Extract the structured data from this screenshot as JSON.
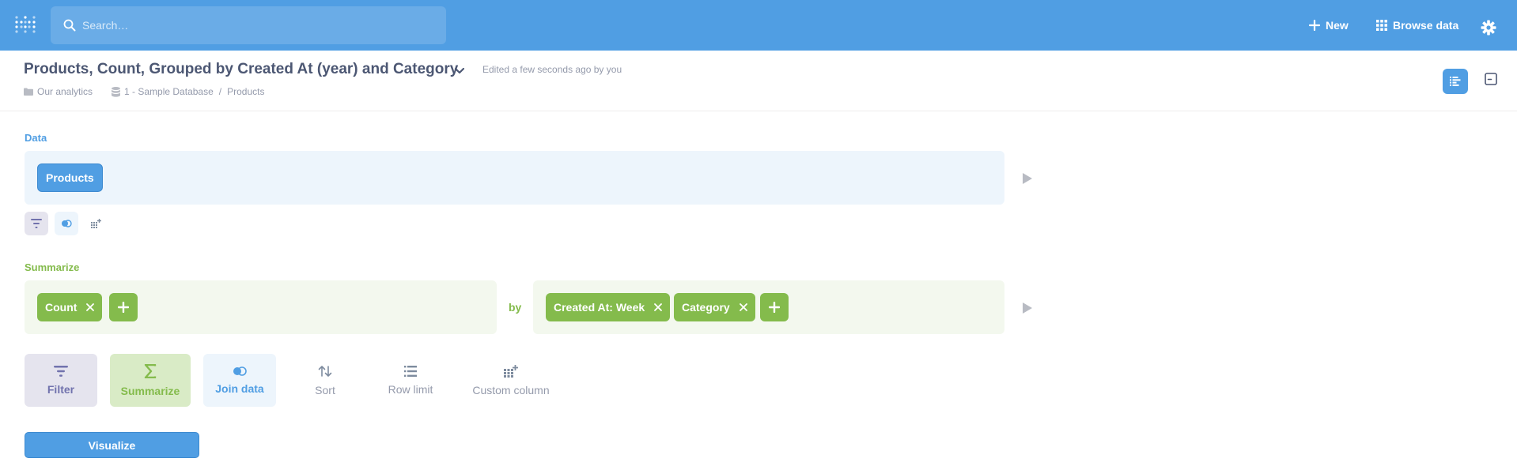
{
  "nav": {
    "search_placeholder": "Search…",
    "new_label": "New",
    "browse_label": "Browse data"
  },
  "header": {
    "title": "Products, Count, Grouped by Created At (year) and Category",
    "edited": "Edited a few seconds ago by you",
    "breadcrumb": {
      "collection": "Our analytics",
      "database": "1 - Sample Database",
      "separator": "/",
      "table": "Products"
    }
  },
  "data_section": {
    "label": "Data",
    "table_pill": "Products"
  },
  "summarize_section": {
    "label": "Summarize",
    "metrics": [
      "Count"
    ],
    "by_label": "by",
    "breakouts": [
      "Created At: Week",
      "Category"
    ]
  },
  "actions": {
    "filter": "Filter",
    "summarize": "Summarize",
    "join": "Join data",
    "sort": "Sort",
    "row_limit": "Row limit",
    "custom_column": "Custom column"
  },
  "visualize_label": "Visualize",
  "colors": {
    "brand": "#509ee3",
    "summarize": "#84bb4c",
    "filter": "#7172ad",
    "text_muted": "#949aab"
  }
}
